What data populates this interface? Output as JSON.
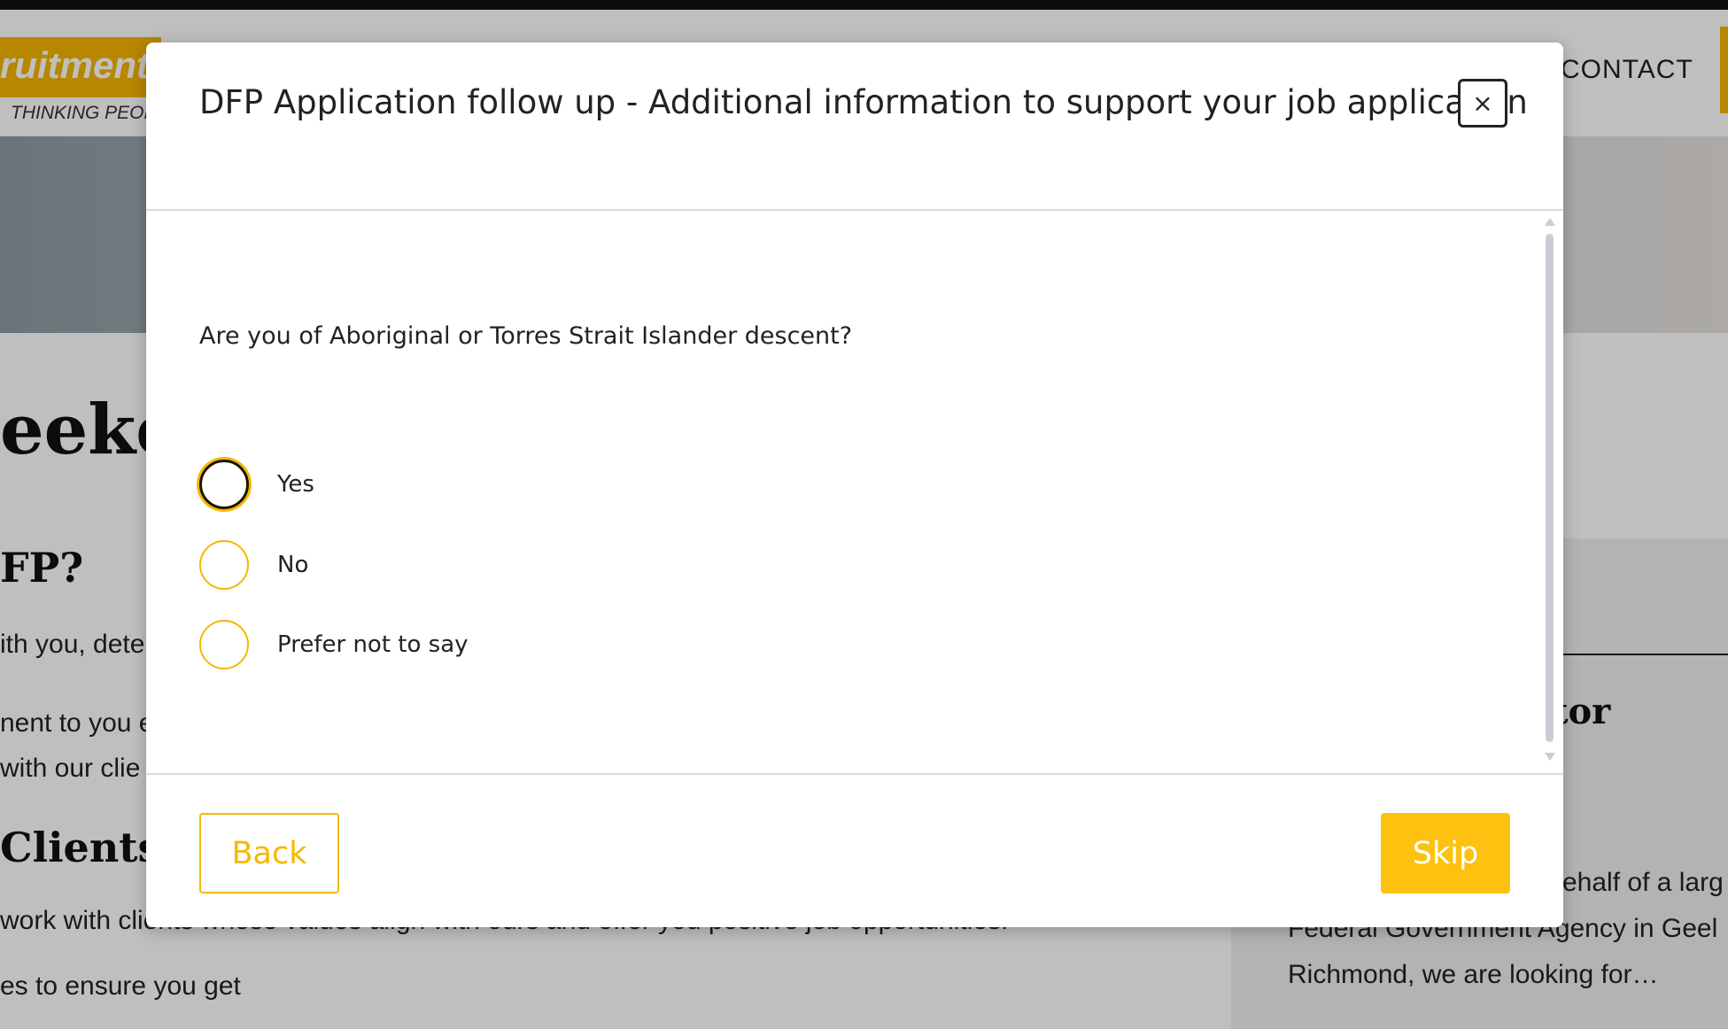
{
  "background_page": {
    "logo": {
      "text": "ruitment",
      "tagline": "THINKING PEOPL"
    },
    "nav": {
      "contact": "CONTACT"
    },
    "heading": "eeke",
    "section_heading_1": "FP?",
    "para_1": "ith you, dete",
    "para_2a": "nent to you e",
    "para_2b": "with our clie",
    "section_heading_2": "Clients",
    "para_3": "work with clients whose values align with ours and offer you positive job opportunities.",
    "para_4": "es to ensure you get",
    "side": {
      "heading": "tor",
      "line_1": "ehalf of a larg",
      "line_2": "Federal Government Agency in Geel",
      "line_3": "Richmond, we are looking for…"
    }
  },
  "modal": {
    "title": "DFP Application follow up - Additional information to support your job application",
    "close_label": "×",
    "question": "Are you of Aboriginal or Torres Strait Islander descent?",
    "options": [
      {
        "label": "Yes",
        "focused": true
      },
      {
        "label": "No",
        "focused": false
      },
      {
        "label": "Prefer not to say",
        "focused": false
      }
    ],
    "back_label": "Back",
    "skip_label": "Skip"
  },
  "colors": {
    "accent": "#f5b800",
    "skip_button": "#fdc10f",
    "overlay": "rgba(0,0,0,0.25)"
  },
  "icons": {
    "close": "close-icon",
    "radio": "radio-circle"
  }
}
